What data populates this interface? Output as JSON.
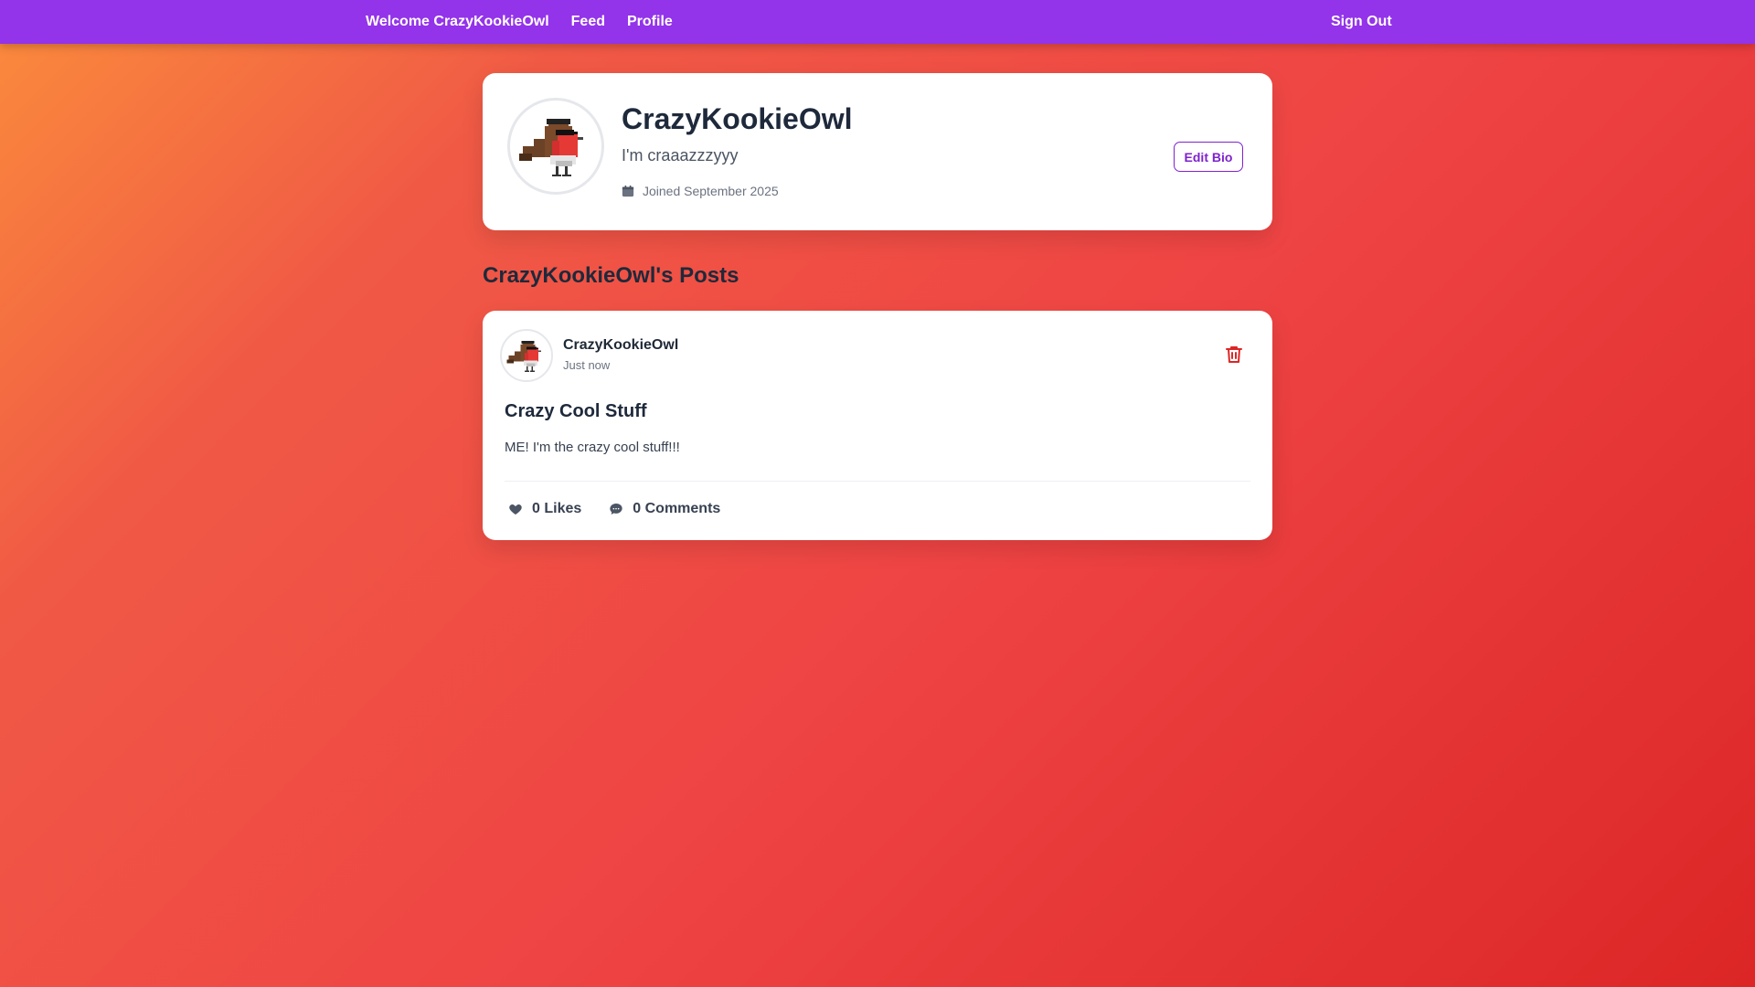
{
  "nav": {
    "welcome": "Welcome CrazyKookieOwl",
    "feed": "Feed",
    "profile": "Profile",
    "sign_out": "Sign Out"
  },
  "profile": {
    "username": "CrazyKookieOwl",
    "bio": "I'm craaazzzyyy",
    "joined": "Joined September 2025",
    "edit_bio_label": "Edit Bio",
    "avatar_icon": "pixel-robin-with-sunglasses-icon"
  },
  "posts_heading": "CrazyKookieOwl's Posts",
  "posts": [
    {
      "author": "CrazyKookieOwl",
      "time": "Just now",
      "title": "Crazy Cool Stuff",
      "body": "ME! I'm the crazy cool stuff!!!",
      "likes": "0 Likes",
      "comments": "0 Comments"
    }
  ],
  "colors": {
    "nav_bg": "#9333ea",
    "accent": "#7e22ce",
    "delete": "#dc2626",
    "bg_gradient_start": "#fb8c3c",
    "bg_gradient_end": "#dc2626"
  }
}
